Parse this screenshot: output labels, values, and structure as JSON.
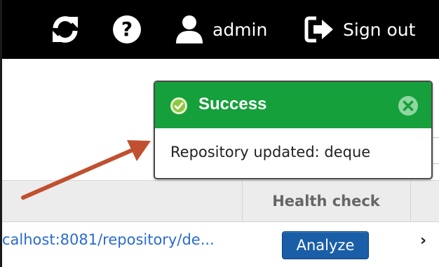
{
  "topbar": {
    "refresh_icon": "refresh-icon",
    "help_icon": "help-icon",
    "user_icon": "user-icon",
    "user_label": "admin",
    "signout_icon": "sign-out-icon",
    "signout_label": "Sign out"
  },
  "toast": {
    "title": "Success",
    "message": "Repository updated: deque",
    "check_icon": "check-circle-icon",
    "close_icon": "close-circle-icon"
  },
  "table": {
    "headers": [
      "Health check"
    ],
    "rows": [
      {
        "url": "calhost:8081/repository/de...",
        "action": "Analyze"
      }
    ]
  },
  "colors": {
    "topbar": "#000000",
    "toast_header": "#16a03c",
    "arrow": "#c0502f",
    "button": "#1a5ea8",
    "link": "#2a6bcf"
  }
}
